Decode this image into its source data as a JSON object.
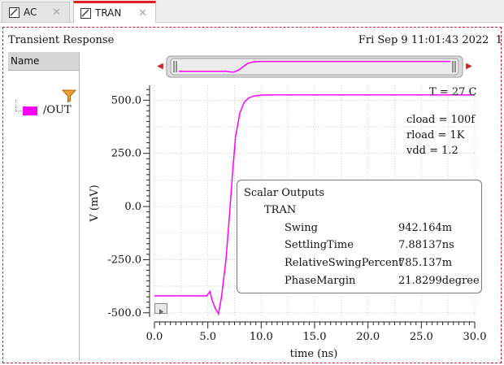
{
  "tabs": [
    {
      "label": "AC",
      "active": false
    },
    {
      "label": "TRAN",
      "active": true
    }
  ],
  "plot": {
    "title": "Transient Response",
    "timestamp": "Fri Sep 9 11:01:43 2022",
    "timestamp_tail": "1",
    "temperature": "T = 27 C",
    "params": [
      "cload = 100f",
      "rload = 1K",
      "vdd = 1.2"
    ]
  },
  "sidebar": {
    "header": "Name",
    "signal": {
      "label": "/OUT",
      "color": "#ff00ff"
    }
  },
  "scalar_outputs": {
    "title": "Scalar Outputs",
    "section": "TRAN",
    "rows": [
      {
        "name": "Swing",
        "value": "942.164m"
      },
      {
        "name": "SettlingTime",
        "value": "7.88137ns"
      },
      {
        "name": "RelativeSwingPercent",
        "value": "785.137m"
      },
      {
        "name": "PhaseMargin",
        "value": "21.8299degree"
      }
    ]
  },
  "chart_data": {
    "type": "line",
    "xlabel": "time (ns)",
    "ylabel": "V (mV)",
    "xlim": [
      0,
      30
    ],
    "ylim": [
      -520,
      570
    ],
    "x_ticks": [
      "0.0",
      "5.0",
      "10.0",
      "15.0",
      "20.0",
      "25.0",
      "30.0"
    ],
    "y_ticks": [
      "500.0",
      "250.0",
      "0.0",
      "-250.0",
      "-500.0"
    ],
    "grid": true,
    "series": [
      {
        "name": "/OUT",
        "color": "#ff00ff",
        "x": [
          0,
          4.9,
          5.2,
          5.4,
          5.7,
          6.0,
          6.3,
          6.7,
          7.0,
          7.3,
          7.6,
          8.0,
          8.4,
          8.8,
          9.3,
          10.0,
          11.0,
          13.0,
          30.0
        ],
        "y": [
          -420,
          -420,
          -400,
          -440,
          -480,
          -505,
          -420,
          -250,
          -60,
          150,
          330,
          440,
          490,
          510,
          520,
          524,
          525,
          525,
          525
        ]
      }
    ]
  }
}
